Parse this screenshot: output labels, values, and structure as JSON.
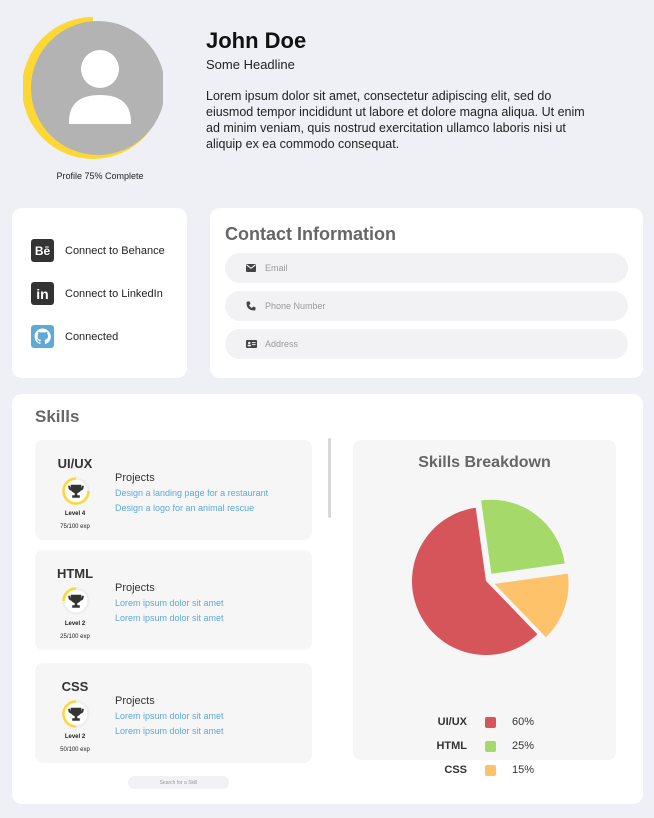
{
  "profile": {
    "name": "John Doe",
    "headline": "Some Headline",
    "bio": "Lorem ipsum dolor sit amet, consectetur adipiscing elit, sed do eiusmod tempor incididunt ut labore et dolore magna aliqua. Ut enim ad minim veniam, quis nostrud exercitation ullamco laboris nisi ut aliquip ex ea commodo consequat.",
    "completion_label": "Profile 75% Complete",
    "completion_fraction": 0.75,
    "ring_color": "#fdd835",
    "avatar_bg": "#b3b3b3"
  },
  "social": {
    "items": [
      {
        "label": "Connect to Behance",
        "icon": "behance-icon",
        "icon_text": "Bē",
        "color": "#333333"
      },
      {
        "label": "Connect to LinkedIn",
        "icon": "linkedin-icon",
        "icon_text": "in",
        "color": "#333333"
      },
      {
        "label": "Connected",
        "icon": "github-icon",
        "icon_text": "",
        "color": "#5ea9d6"
      }
    ]
  },
  "contact": {
    "title": "Contact Information",
    "fields": [
      {
        "placeholder": "Email",
        "icon": "envelope-icon"
      },
      {
        "placeholder": "Phone Number",
        "icon": "phone-icon"
      },
      {
        "placeholder": "Address",
        "icon": "address-card-icon"
      }
    ]
  },
  "skills": {
    "title": "Skills",
    "projects_label": "Projects",
    "search_placeholder": "Search for a Skill",
    "items": [
      {
        "name": "UI/UX",
        "level": "Level 4",
        "exp": "75/100 exp",
        "exp_fraction": 0.75,
        "projects": [
          "Design a landing page for a restaurant",
          "Design a logo for an animal rescue"
        ]
      },
      {
        "name": "HTML",
        "level": "Level 2",
        "exp": "25/100 exp",
        "exp_fraction": 0.25,
        "projects": [
          "Lorem ipsum dolor sit amet",
          "Lorem ipsum dolor sit amet"
        ]
      },
      {
        "name": "CSS",
        "level": "Level 2",
        "exp": "50/100 exp",
        "exp_fraction": 0.5,
        "projects": [
          "Lorem ipsum dolor sit amet",
          "Lorem ipsum dolor sit amet"
        ]
      }
    ],
    "breakdown_title": "Skills Breakdown"
  },
  "chart_data": {
    "type": "pie",
    "title": "Skills Breakdown",
    "categories": [
      "UI/UX",
      "HTML",
      "CSS"
    ],
    "values": [
      60,
      25,
      15
    ],
    "value_labels": [
      "60%",
      "25%",
      "15%"
    ],
    "colors": [
      "#d6555b",
      "#a5d96a",
      "#fdc26a"
    ],
    "legend": "bottom"
  }
}
